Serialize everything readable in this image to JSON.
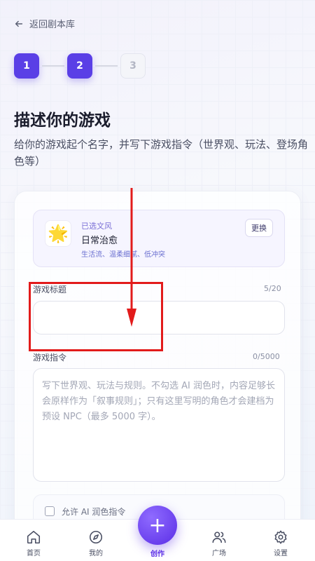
{
  "nav": {
    "back_label": "返回剧本库"
  },
  "steps": [
    "1",
    "2",
    "3"
  ],
  "page": {
    "title": "描述你的游戏",
    "subtitle": "给你的游戏起个名字，并写下游戏指令（世界观、玩法、登场角色等）"
  },
  "style_card": {
    "kicker": "已选文风",
    "name": "日常治愈",
    "tags": "生活流、温柔细腻、低冲突",
    "change_label": "更换",
    "icon": "star-icon"
  },
  "title_field": {
    "label": "游戏标题",
    "counter": "5/20",
    "value": ""
  },
  "instruction_field": {
    "label": "游戏指令",
    "counter": "0/5000",
    "placeholder": "写下世界观、玩法与规则。不勾选 AI 润色时，内容足够长会原样作为「叙事规则」；只有这里写明的角色才会建档为预设 NPC（最多 5000 字）。"
  },
  "polish_option": {
    "label": "允许 AI 润色指令",
    "checked": false
  },
  "tabbar": {
    "items": [
      {
        "label": "首页",
        "icon": "home-icon"
      },
      {
        "label": "我的",
        "icon": "compass-icon"
      },
      {
        "label": "创作",
        "icon": "plus-icon"
      },
      {
        "label": "广场",
        "icon": "users-icon"
      },
      {
        "label": "设置",
        "icon": "gear-icon"
      }
    ]
  },
  "colors": {
    "accent": "#5a3fe6",
    "annotation": "#e21b1b"
  }
}
